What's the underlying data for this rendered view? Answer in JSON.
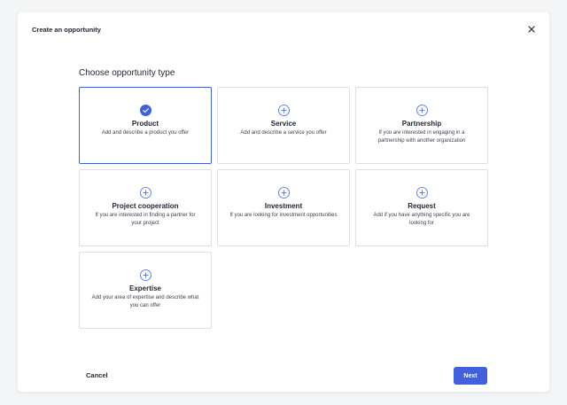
{
  "modal": {
    "title": "Create an opportunity",
    "section_title": "Choose opportunity type",
    "cancel_label": "Cancel",
    "next_label": "Next"
  },
  "colors": {
    "accent": "#4060dc",
    "card_border": "#dcdfe6"
  },
  "cards": [
    {
      "title": "Product",
      "description": "Add and describe a product you offer",
      "icon": "check-circle-icon",
      "selected": true
    },
    {
      "title": "Service",
      "description": "Add and describe a service you offer",
      "icon": "plus-circle-icon",
      "selected": false
    },
    {
      "title": "Partnership",
      "description": "If you are interested in engaging in a partnership with another organization",
      "icon": "plus-circle-icon",
      "selected": false
    },
    {
      "title": "Project cooperation",
      "description": "If you are interested in finding a partner for your project",
      "icon": "plus-circle-icon",
      "selected": false
    },
    {
      "title": "Investment",
      "description": "If you are looking for investment opportunities",
      "icon": "plus-circle-icon",
      "selected": false
    },
    {
      "title": "Request",
      "description": "Add if you have anything specific you are looking for",
      "icon": "plus-circle-icon",
      "selected": false
    },
    {
      "title": "Expertise",
      "description": "Add your area of expertise and describe what you can offer",
      "icon": "plus-circle-icon",
      "selected": false
    }
  ]
}
